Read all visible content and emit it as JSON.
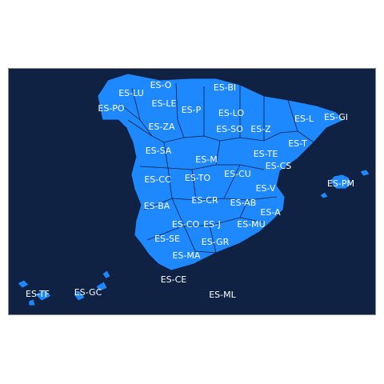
{
  "map": {
    "colors": {
      "ocean": "#0f2244",
      "land": "#1e88ff",
      "border": "#0c1f3f",
      "label": "#ffffff"
    },
    "regions": [
      {
        "code": "ES-O"
      },
      {
        "code": "ES-LU"
      },
      {
        "code": "ES-BI"
      },
      {
        "code": "ES-LE"
      },
      {
        "code": "ES-PO"
      },
      {
        "code": "ES-P"
      },
      {
        "code": "ES-LO"
      },
      {
        "code": "ES-L"
      },
      {
        "code": "ES-GI"
      },
      {
        "code": "ES-ZA"
      },
      {
        "code": "ES-SO"
      },
      {
        "code": "ES-Z"
      },
      {
        "code": "ES-T"
      },
      {
        "code": "ES-SA"
      },
      {
        "code": "ES-TE"
      },
      {
        "code": "ES-M"
      },
      {
        "code": "ES-CS"
      },
      {
        "code": "ES-CC"
      },
      {
        "code": "ES-TO"
      },
      {
        "code": "ES-CU"
      },
      {
        "code": "ES-PM"
      },
      {
        "code": "ES-V"
      },
      {
        "code": "ES-CR"
      },
      {
        "code": "ES-AB"
      },
      {
        "code": "ES-BA"
      },
      {
        "code": "ES-A"
      },
      {
        "code": "ES-CO"
      },
      {
        "code": "ES-J"
      },
      {
        "code": "ES-MU"
      },
      {
        "code": "ES-SE"
      },
      {
        "code": "ES-GR"
      },
      {
        "code": "ES-MA"
      },
      {
        "code": "ES-CE"
      },
      {
        "code": "ES-TF"
      },
      {
        "code": "ES-GC"
      },
      {
        "code": "ES-ML"
      }
    ]
  }
}
